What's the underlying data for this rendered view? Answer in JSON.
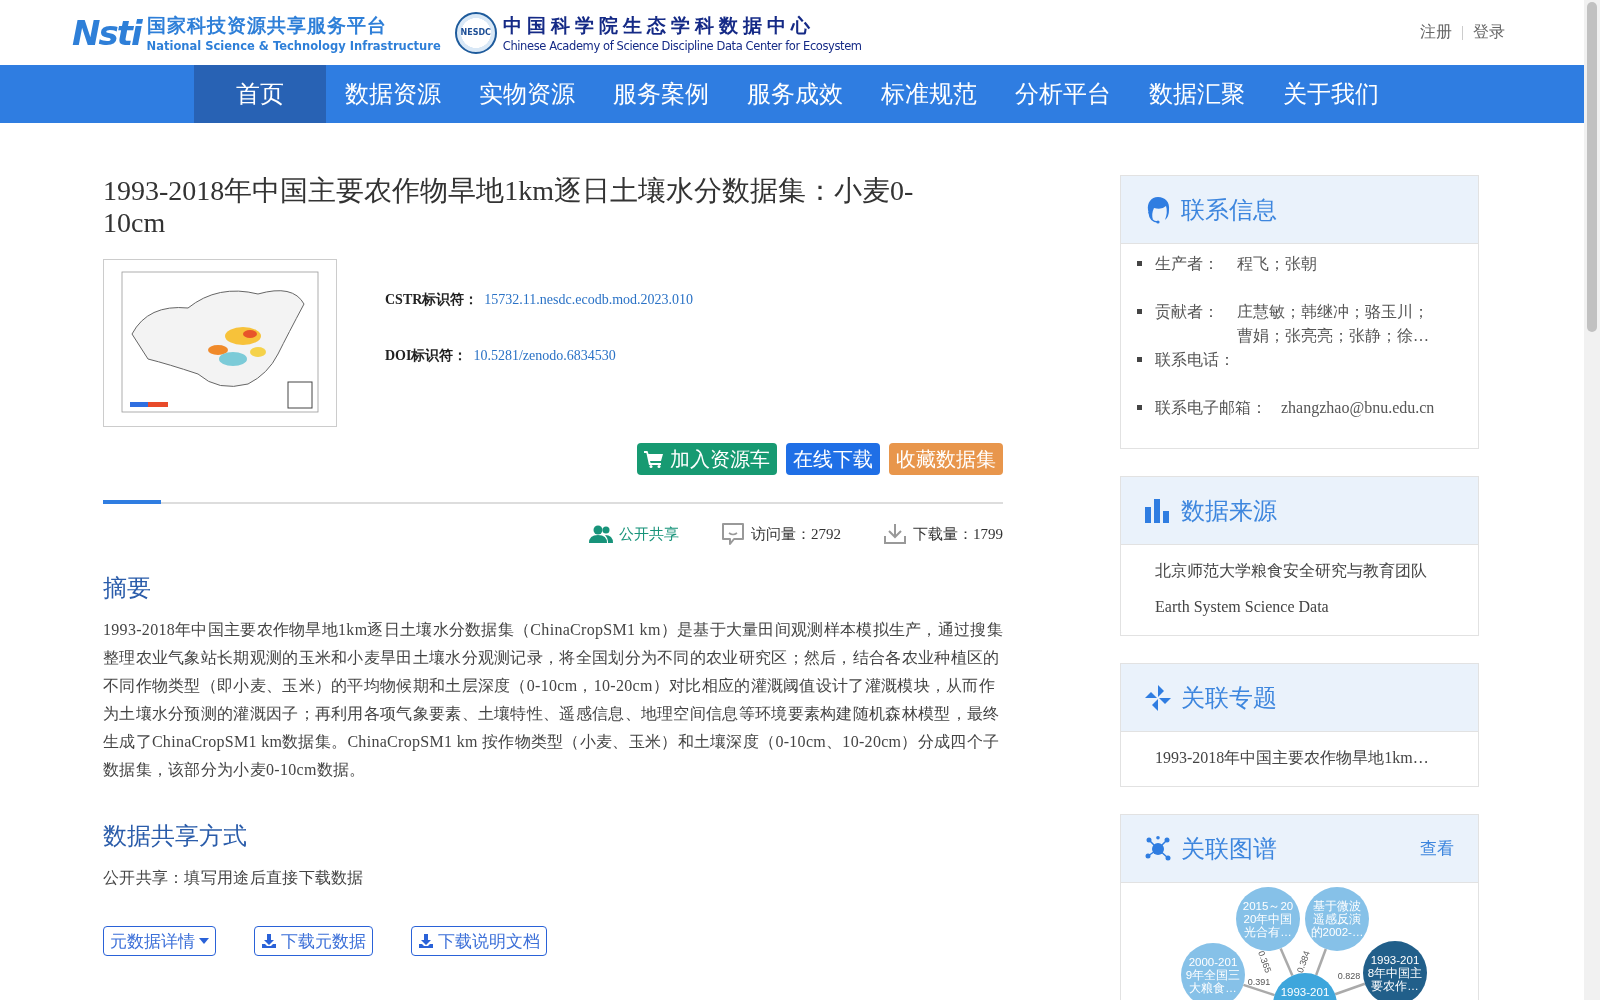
{
  "header": {
    "logo_mark": "Nsti",
    "platform_name": "国家科技资源共享服务平台",
    "platform_name_en": "National Science & Technology Infrastructure",
    "badge_text": "NESDC",
    "center_name": "中国科学院生态学科数据中心",
    "center_name_en": "Chinese Academy of Science Discipline Data Center for Ecosystem",
    "links": [
      "注册",
      "登录"
    ]
  },
  "nav": [
    {
      "label": "首页",
      "selected": true
    },
    {
      "label": "数据资源",
      "selected": false
    },
    {
      "label": "实物资源",
      "selected": false
    },
    {
      "label": "服务案例",
      "selected": false
    },
    {
      "label": "服务成效",
      "selected": false
    },
    {
      "label": "标准规范",
      "selected": false
    },
    {
      "label": "分析平台",
      "selected": false
    },
    {
      "label": "数据汇聚",
      "selected": false
    },
    {
      "label": "关于我们",
      "selected": false
    }
  ],
  "dataset": {
    "title": "1993-2018年中国主要农作物旱地1km逐日土壤水分数据集：小麦0-10cm",
    "identifiers": [
      {
        "label": "CSTR标识符：",
        "value": "15732.11.nesdc.ecodb.mod.2023.010"
      },
      {
        "label": "DOI标识符：",
        "value": "10.5281/zenodo.6834530"
      }
    ],
    "actions": [
      {
        "label": "加入资源车",
        "kind": "cart"
      },
      {
        "label": "在线下载",
        "kind": "download"
      },
      {
        "label": "收藏数据集",
        "kind": "favorite"
      }
    ],
    "stats": [
      {
        "kind": "share",
        "label": "公开共享"
      },
      {
        "kind": "visits",
        "label": "访问量：",
        "value": "2792"
      },
      {
        "kind": "downloads",
        "label": "下载量：",
        "value": "1799"
      }
    ],
    "abstract": {
      "heading": "摘要",
      "text": "1993-2018年中国主要农作物旱地1km逐日土壤水分数据集（ChinaCropSM1 km）是基于大量田间观测样本模拟生产，通过搜集整理农业气象站长期观测的玉米和小麦旱田土壤水分观测记录，将全国划分为不同的农业研究区；然后，结合各农业种植区的不同作物类型（即小麦、玉米）的平均物候期和土层深度（0-10cm，10-20cm）对比相应的灌溉阈值设计了灌溉模块，从而作为土壤水分预测的灌溉因子；再利用各项气象要素、土壤特性、遥感信息、地理空间信息等环境要素构建随机森林模型，最终生成了ChinaCropSM1 km数据集。ChinaCropSM1 km 按作物类型（小麦、玉米）和土壤深度（0-10cm、10-20cm）分成四个子数据集，该部分为小麦0-10cm数据。"
    },
    "sharing": {
      "heading": "数据共享方式",
      "text": "公开共享：填写用途后直接下载数据"
    },
    "bottom_buttons": [
      {
        "label": "元数据详情",
        "kind": "dropdown"
      },
      {
        "label": "下载元数据",
        "kind": "download"
      },
      {
        "label": "下载说明文档",
        "kind": "download"
      }
    ]
  },
  "sidebar": [
    {
      "kind": "contact",
      "heading": "联系信息",
      "items": [
        {
          "label": "生产者：",
          "value": "程飞；张朝"
        },
        {
          "label": "贡献者：",
          "value": "庄慧敏；韩继冲；骆玉川；曹娟；张亮亮；张静；徐…"
        },
        {
          "label": "联系电话："
        },
        {
          "label": "联系电子邮箱：",
          "value": "zhangzhao@bnu.edu.cn"
        }
      ]
    },
    {
      "kind": "sources",
      "heading": "数据来源",
      "items": [
        "北京师范大学粮食安全研究与教育团队",
        "Earth System Science Data"
      ]
    },
    {
      "kind": "topics",
      "heading": "关联专题",
      "items": [
        "1993-2018年中国主要农作物旱地1km…"
      ]
    },
    {
      "kind": "graph",
      "heading": "关联图谱",
      "link": "查看",
      "nodes": [
        {
          "lines": [
            "2000-201",
            "9年全国三",
            "大粮食…"
          ],
          "color": "#86c1e8"
        },
        {
          "lines": [
            "2015～20",
            "20年中国",
            "光合有…"
          ],
          "color": "#86c1e8"
        },
        {
          "lines": [
            "基于微波",
            "遥感反演",
            "的2002-…"
          ],
          "color": "#86c1e8"
        },
        {
          "lines": [
            "1993-201"
          ],
          "color": "#3ea6dc"
        },
        {
          "lines": [
            "1993-201",
            "8年中国主",
            "要农作…"
          ],
          "color": "#215f8a"
        }
      ],
      "edges": [
        {
          "weight": "0.391"
        },
        {
          "weight": "0.365"
        },
        {
          "weight": "0.384"
        },
        {
          "weight": "0.828"
        }
      ]
    }
  ]
}
